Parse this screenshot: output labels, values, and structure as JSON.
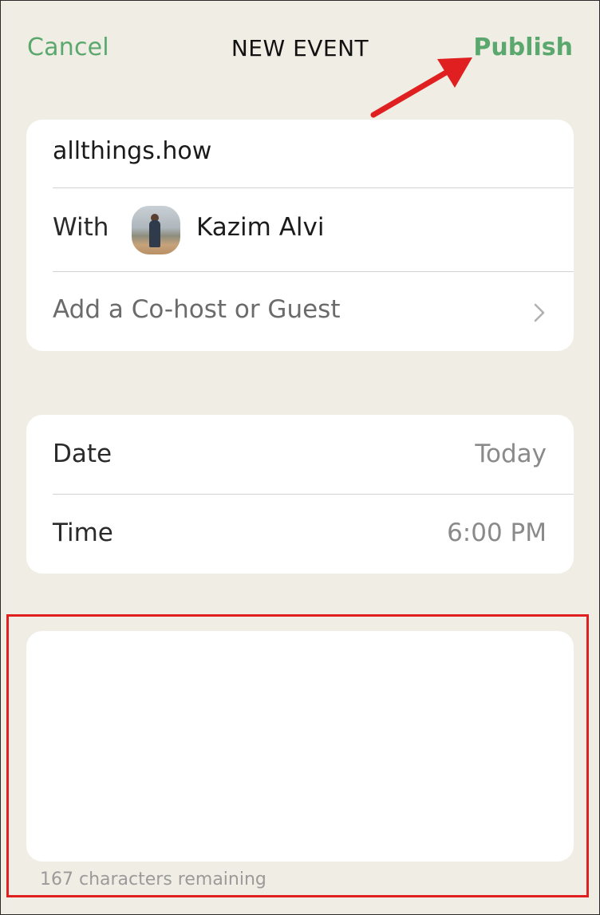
{
  "nav": {
    "cancel_label": "Cancel",
    "title": "NEW EVENT",
    "publish_label": "Publish"
  },
  "event": {
    "title_value": "allthings.how",
    "with_label": "With",
    "host_name": "Kazim Alvi",
    "add_guest_label": "Add a Co-host or Guest"
  },
  "schedule": {
    "date_label": "Date",
    "date_value": "Today",
    "time_label": "Time",
    "time_value": "6:00 PM"
  },
  "description": {
    "value": "",
    "chars_remaining": "167 characters remaining"
  },
  "colors": {
    "accent_green": "#5aa86e",
    "background": "#f0ede4",
    "annotation_red": "#e02020"
  },
  "icons": {
    "chevron": "chevron-right-icon",
    "annotation_arrow": "arrow-annotation-icon"
  }
}
